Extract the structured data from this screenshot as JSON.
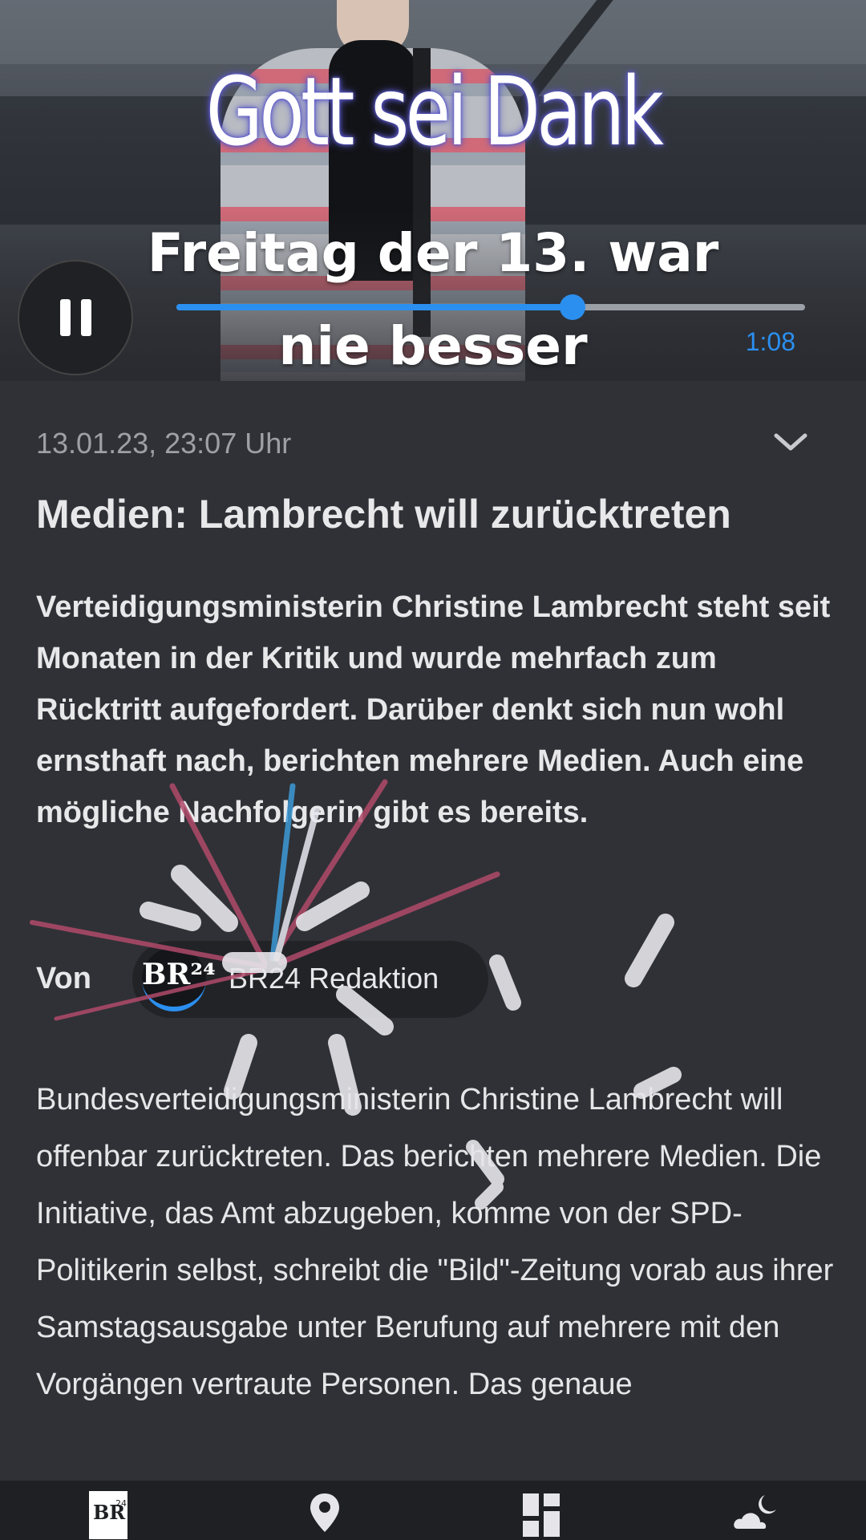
{
  "video": {
    "caption_line1": "Gott sei Dank",
    "caption_line2": "Freitag der 13. war nie besser",
    "progress": 0.63,
    "time": "1:08",
    "accent_color": "#2b8ff0"
  },
  "article": {
    "date": "13.01.23, 23:07 Uhr",
    "title": "Medien: Lambrecht will zurücktreten",
    "lead": "Verteidigungsministerin Christine Lambrecht steht seit Monaten in der Kritik und wurde mehrfach zum Rücktritt aufgefordert. Darüber denkt sich nun wohl ernsthaft nach, berichten mehrere Medien. Auch eine mögliche Nachfolgerin gibt es bereits.",
    "author_label": "Von",
    "author_logo": "BR²⁴",
    "author_name": "BR24 Redaktion",
    "body": "Bundesverteidigungsministerin Christine Lambrecht will offenbar zurücktreten. Das berichten mehrere Medien. Die Initiative, das Amt abzugeben, komme von der SPD-Politikerin selbst, schreibt die \"Bild\"-Zeitung vorab aus ihrer Samstagsausgabe unter Berufung auf mehrere mit den Vorgängen vertraute Personen. Das genaue"
  },
  "bottom_nav": {
    "items": [
      {
        "icon": "br24-logo-icon"
      },
      {
        "icon": "location-pin-icon"
      },
      {
        "icon": "dashboard-icon"
      },
      {
        "icon": "weather-icon"
      }
    ],
    "br_logo_text": "BR²⁴"
  }
}
